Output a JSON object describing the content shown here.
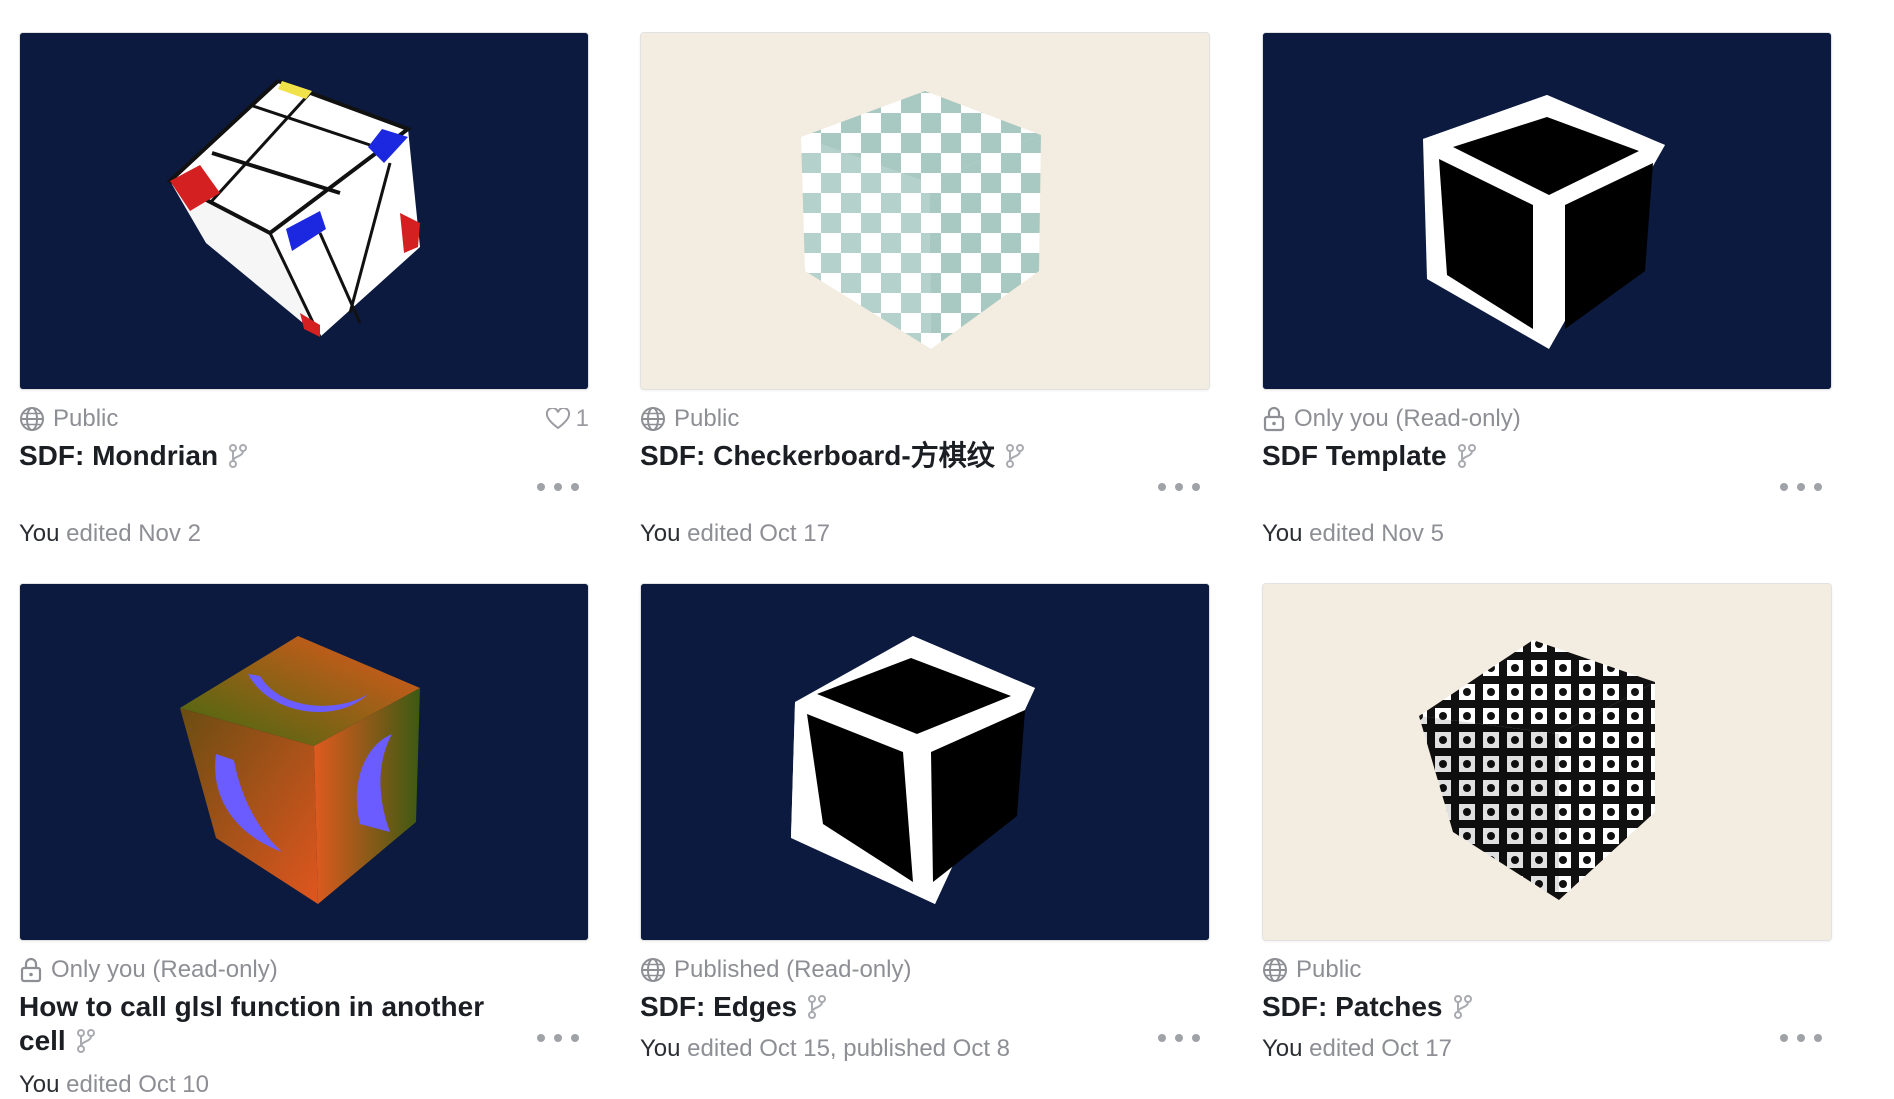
{
  "colors": {
    "navy_bg": "#0b1a3e",
    "cream_bg": "#f3ece0",
    "checker_teal": "#a8c9c2",
    "muted_text": "#8d8f94"
  },
  "notebooks": [
    {
      "visibility": "Public",
      "visibility_icon": "globe-icon",
      "likes": "1",
      "title": "SDF: Mondrian",
      "edited_by": "You",
      "edited_text": " edited Nov 2",
      "thumbnail": "mondrian-cube"
    },
    {
      "visibility": "Public",
      "visibility_icon": "globe-icon",
      "title": "SDF: Checkerboard-方棋纹",
      "edited_by": "You",
      "edited_text": " edited Oct 17",
      "thumbnail": "checkerboard-cube"
    },
    {
      "visibility": "Only you (Read-only)",
      "visibility_icon": "lock-icon",
      "title": "SDF Template",
      "edited_by": "You",
      "edited_text": " edited Nov 5",
      "thumbnail": "template-cube"
    },
    {
      "visibility": "Only you (Read-only)",
      "visibility_icon": "lock-icon",
      "title": "How to call glsl function in another cell",
      "edited_by": "You",
      "edited_text": " edited Oct 10",
      "thumbnail": "gradient-cube"
    },
    {
      "visibility": "Published (Read-only)",
      "visibility_icon": "globe-icon",
      "title": "SDF: Edges",
      "edited_by": "You",
      "edited_text": " edited Oct 15, published Oct 8",
      "thumbnail": "edges-cube"
    },
    {
      "visibility": "Public",
      "visibility_icon": "globe-icon",
      "title": "SDF: Patches",
      "edited_by": "You",
      "edited_text": " edited Oct 17",
      "thumbnail": "patches-cube"
    }
  ]
}
